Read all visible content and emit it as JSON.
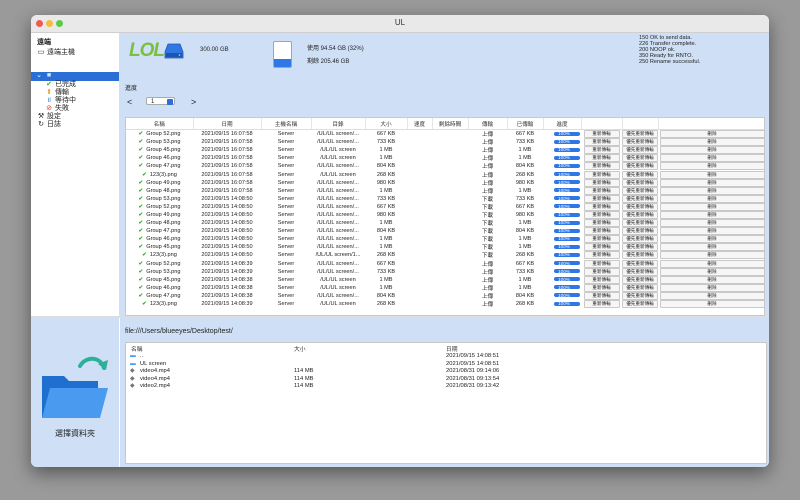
{
  "app": {
    "title": "UL"
  },
  "sidebar": {
    "header": "遠端",
    "items": [
      {
        "label": "遠端主機",
        "icon": "server-icon"
      },
      {
        "label": "",
        "icon": "folder-icon"
      },
      {
        "label": "已完成",
        "icon": "check-icon"
      },
      {
        "label": "傳輸",
        "icon": "transfer-icon"
      },
      {
        "label": "等待中",
        "icon": "pause-icon"
      },
      {
        "label": "失敗",
        "icon": "error-icon"
      },
      {
        "label": "設定",
        "icon": "wrench-icon"
      },
      {
        "label": "日誌",
        "icon": "log-icon"
      }
    ]
  },
  "disk": {
    "logo": "LOL",
    "size": "300.00 GB",
    "used": "使用 94.54 GB (32%)",
    "free": "剩餘 205.46 GB",
    "used_fraction": 0.32
  },
  "log": [
    "150 OK to send data.",
    "226 Transfer complete.",
    "200 NOOP ok.",
    "350 Ready for RNTO.",
    "250 Rename successful."
  ],
  "progress": {
    "title": "進度",
    "prev": "<",
    "page": "1",
    "next": ">"
  },
  "table": {
    "columns": [
      "名稱",
      "日期",
      "主機名稱",
      "目錄",
      "大小",
      "速度",
      "剩餘時間",
      "傳輸",
      "已傳輸",
      "進度",
      "",
      "",
      ""
    ],
    "buttons": {
      "retry": "重新傳輸",
      "priority": "優先重新傳輸",
      "delete": "刪除"
    },
    "percent": "100%",
    "rows": [
      [
        "Group 52.png",
        "2021/09/15 16:07:58",
        "Server",
        "/UL/UL screen/...",
        "667 KB",
        "上傳",
        "667 KB"
      ],
      [
        "Group 53.png",
        "2021/09/15 16:07:58",
        "Server",
        "/UL/UL screen/...",
        "733 KB",
        "上傳",
        "733 KB"
      ],
      [
        "Group 45.png",
        "2021/09/15 16:07:58",
        "Server",
        "/UL/UL screen",
        "1 MB",
        "上傳",
        "1 MB"
      ],
      [
        "Group 46.png",
        "2021/09/15 16:07:58",
        "Server",
        "/UL/UL screen",
        "1 MB",
        "上傳",
        "1 MB"
      ],
      [
        "Group 47.png",
        "2021/09/15 16:07:58",
        "Server",
        "/UL/UL screen/...",
        "804 KB",
        "上傳",
        "804 KB"
      ],
      [
        "123(3).png",
        "2021/09/15 16:07:58",
        "Server",
        "/UL/UL screen",
        "268 KB",
        "上傳",
        "268 KB"
      ],
      [
        "Group 49.png",
        "2021/09/15 16:07:58",
        "Server",
        "/UL/UL screen/...",
        "980 KB",
        "上傳",
        "980 KB"
      ],
      [
        "Group 48.png",
        "2021/09/15 16:07:58",
        "Server",
        "/UL/UL screen/...",
        "1 MB",
        "上傳",
        "1 MB"
      ],
      [
        "Group 53.png",
        "2021/09/15 14:08:50",
        "Server",
        "/UL/UL screen/...",
        "733 KB",
        "下載",
        "733 KB"
      ],
      [
        "Group 52.png",
        "2021/09/15 14:08:50",
        "Server",
        "/UL/UL screen/...",
        "667 KB",
        "下載",
        "667 KB"
      ],
      [
        "Group 49.png",
        "2021/09/15 14:08:50",
        "Server",
        "/UL/UL screen/...",
        "980 KB",
        "下載",
        "980 KB"
      ],
      [
        "Group 48.png",
        "2021/09/15 14:08:50",
        "Server",
        "/UL/UL screen/...",
        "1 MB",
        "下載",
        "1 MB"
      ],
      [
        "Group 47.png",
        "2021/09/15 14:08:50",
        "Server",
        "/UL/UL screen/...",
        "804 KB",
        "下載",
        "804 KB"
      ],
      [
        "Group 46.png",
        "2021/09/15 14:08:50",
        "Server",
        "/UL/UL screen/...",
        "1 MB",
        "下載",
        "1 MB"
      ],
      [
        "Group 45.png",
        "2021/09/15 14:08:50",
        "Server",
        "/UL/UL screen/...",
        "1 MB",
        "下載",
        "1 MB"
      ],
      [
        "123(3).png",
        "2021/09/15 14:08:50",
        "Server",
        "/UL/UL screen/1...",
        "268 KB",
        "下載",
        "268 KB"
      ],
      [
        "Group 52.png",
        "2021/09/15 14:08:39",
        "Server",
        "/UL/UL screen/...",
        "667 KB",
        "上傳",
        "667 KB"
      ],
      [
        "Group 53.png",
        "2021/09/15 14:08:39",
        "Server",
        "/UL/UL screen/...",
        "733 KB",
        "上傳",
        "733 KB"
      ],
      [
        "Group 45.png",
        "2021/09/15 14:08:38",
        "Server",
        "/UL/UL screen",
        "1 MB",
        "上傳",
        "1 MB"
      ],
      [
        "Group 46.png",
        "2021/09/15 14:08:38",
        "Server",
        "/UL/UL screen",
        "1 MB",
        "上傳",
        "1 MB"
      ],
      [
        "Group 47.png",
        "2021/09/15 14:08:38",
        "Server",
        "/UL/UL screen/...",
        "804 KB",
        "上傳",
        "804 KB"
      ],
      [
        "123(3).png",
        "2021/09/15 14:08:39",
        "Server",
        "/UL/UL screen",
        "268 KB",
        "上傳",
        "268 KB"
      ]
    ]
  },
  "local": {
    "choose_label": "選擇資料夾",
    "path": "file:///Users/blueeyes/Desktop/test/",
    "columns": [
      "名稱",
      "大小",
      "日期"
    ],
    "files": [
      {
        "name": "..",
        "size": "",
        "date": "2021/09/15 14:08:51",
        "icon": "folder-icon"
      },
      {
        "name": "UL screen",
        "size": "",
        "date": "2021/09/15 14:08:51",
        "icon": "folder-icon"
      },
      {
        "name": "video4.mp4",
        "size": "114 MB",
        "date": "2021/08/31 09:14:06",
        "icon": "file-icon"
      },
      {
        "name": "video4.mp4",
        "size": "114 MB",
        "date": "2021/08/31 09:13:54",
        "icon": "file-icon"
      },
      {
        "name": "video2.mp4",
        "size": "114 MB",
        "date": "2021/08/31 09:13:42",
        "icon": "file-icon"
      }
    ]
  }
}
